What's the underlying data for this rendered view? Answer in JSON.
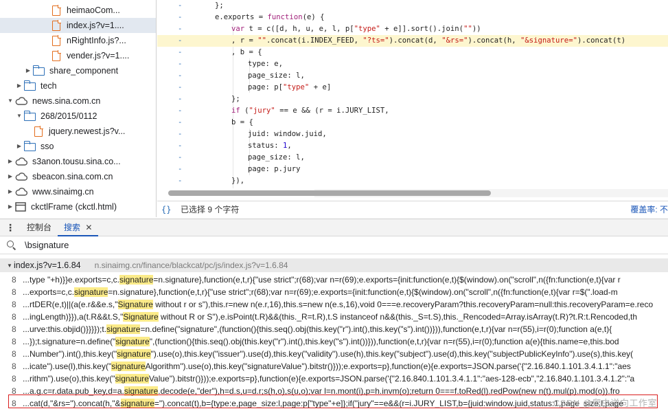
{
  "tree": {
    "items": [
      {
        "label": "heimaoCom...",
        "icon": "file-icon",
        "chevron": "",
        "depth": 5,
        "selected": false
      },
      {
        "label": "index.js?v=1....",
        "icon": "file-icon",
        "chevron": "",
        "depth": 5,
        "selected": true
      },
      {
        "label": "nRightInfo.js?...",
        "icon": "file-icon",
        "chevron": "",
        "depth": 5,
        "selected": false
      },
      {
        "label": "vender.js?v=1....",
        "icon": "file-icon",
        "chevron": "",
        "depth": 5,
        "selected": false
      },
      {
        "label": "share_component",
        "icon": "folder-icon",
        "chevron": "▶",
        "depth": 3,
        "selected": false
      },
      {
        "label": "tech",
        "icon": "folder-icon",
        "chevron": "▶",
        "depth": 2,
        "selected": false
      },
      {
        "label": "news.sina.com.cn",
        "icon": "cloud-icon",
        "chevron": "▼",
        "depth": 1,
        "selected": false
      },
      {
        "label": "268/2015/0112",
        "icon": "folder-icon",
        "chevron": "▼",
        "depth": 2,
        "selected": false
      },
      {
        "label": "jquery.newest.js?v...",
        "icon": "file-icon",
        "chevron": "",
        "depth": 3,
        "selected": false
      },
      {
        "label": "sso",
        "icon": "folder-icon",
        "chevron": "▶",
        "depth": 2,
        "selected": false
      },
      {
        "label": "s3anon.tousu.sina.co...",
        "icon": "cloud-icon",
        "chevron": "▶",
        "depth": 1,
        "selected": false
      },
      {
        "label": "sbeacon.sina.com.cn",
        "icon": "cloud-icon",
        "chevron": "▶",
        "depth": 1,
        "selected": false
      },
      {
        "label": "www.sinaimg.cn",
        "icon": "cloud-icon",
        "chevron": "▶",
        "depth": 1,
        "selected": false
      },
      {
        "label": "ckctlFrame (ckctl.html)",
        "icon": "frame-icon",
        "chevron": "▶",
        "depth": 1,
        "selected": false
      }
    ]
  },
  "code": {
    "lines": [
      {
        "text": "};",
        "indent": 1,
        "highlight": false
      },
      {
        "text": "e.exports = function(e) {",
        "indent": 1,
        "highlight": false
      },
      {
        "text": "var t = c([d, h, u, e, l, p[\"type\" + e]].sort().join(\"\"))",
        "indent": 2,
        "highlight": false
      },
      {
        "text": ", r = \"\".concat(i.INDEX_FEED, \"?ts=\").concat(d, \"&rs=\").concat(h, \"&signature=\").concat(t)",
        "indent": 2,
        "highlight": true
      },
      {
        "text": ", b = {",
        "indent": 2,
        "highlight": false
      },
      {
        "text": "type: e,",
        "indent": 3,
        "highlight": false
      },
      {
        "text": "page_size: l,",
        "indent": 3,
        "highlight": false
      },
      {
        "text": "page: p[\"type\" + e]",
        "indent": 3,
        "highlight": false
      },
      {
        "text": "};",
        "indent": 2,
        "highlight": false
      },
      {
        "text": "if (\"jury\" == e && (r = i.JURY_LIST,",
        "indent": 2,
        "highlight": false
      },
      {
        "text": "b = {",
        "indent": 2,
        "highlight": false
      },
      {
        "text": "juid: window.juid,",
        "indent": 3,
        "highlight": false
      },
      {
        "text": "status: 1,",
        "indent": 3,
        "highlight": false
      },
      {
        "text": "page_size: l,",
        "indent": 3,
        "highlight": false
      },
      {
        "text": "page: p.jury",
        "indent": 3,
        "highlight": false
      },
      {
        "text": "}),",
        "indent": 2,
        "highlight": false
      }
    ]
  },
  "status": {
    "brace_icon": "{}",
    "selection": "已选择 9 个字符",
    "coverage": "覆盖率: 不"
  },
  "drawer": {
    "menu_icon": "⋮",
    "tabs": [
      {
        "label": "控制台",
        "active": false,
        "closable": false
      },
      {
        "label": "搜索",
        "active": true,
        "closable": true
      }
    ],
    "close_glyph": "✕"
  },
  "search": {
    "query": "\\bsignature"
  },
  "results": {
    "file_name": "index.js?v=1.6.84",
    "file_path": "n.sinaimg.cn/finance/blackcat/pc/js/index.js?v=1.6.84",
    "rows": [
      {
        "line": "8",
        "text": "...type \"+h)}}e.exports=c,c.[[signature]]=n.signature},function(e,t,r){\"use strict\";r(68);var n=r(69);e.exports={init:function(e,t){$(window).on(\"scroll\",n({fn:function(e,t){var r"
      },
      {
        "line": "8",
        "text": "...exports=c,c.[[signature]]=n.signature},function(e,t,r){\"use strict\";r(68);var n=r(69);e.exports={init:function(e,t){$(window).on(\"scroll\",n({fn:function(e,t){var r=$(\".load-m"
      },
      {
        "line": "8",
        "text": "...rtDER(e,t)||(a(e.r&&e.s,\"[[Signature]] without r or s\"),this.r=new n(e.r,16),this.s=new n(e.s,16),void 0===e.recoveryParam?this.recoveryParam=null:this.recoveryParam=e.reco"
      },
      {
        "line": "8",
        "text": "...ingLength)}}),a(t.R&&t.S,\"[[Signature]] without R or S\"),e.isPoint(t.R)&&(this._R=t.R),t.S instanceof n&&(this._S=t.S),this._Rencoded=Array.isArray(t.R)?t.R:t.Rencoded,th"
      },
      {
        "line": "8",
        "text": "...urve:this.objid()}}}});t.[[signature]]=n.define(\"signature\",(function(){this.seq().obj(this.key(\"r\").int(),this.key(\"s\").int())})),function(e,t,r){var n=r(55),i=r(0);function a(e,t){"
      },
      {
        "line": "8",
        "text": "...});t.signature=n.define(\"[[signature]]\",(function(){this.seq().obj(this.key(\"r\").int(),this.key(\"s\").int())})),function(e,t,r){var n=r(55),i=r(0);function a(e){this.name=e,this.bod"
      },
      {
        "line": "8",
        "text": "...Number\").int(),this.key(\"[[signature]]\").use(o),this.key(\"issuer\").use(d),this.key(\"validity\").use(h),this.key(\"subject\").use(d),this.key(\"subjectPublicKeyInfo\").use(s),this.key("
      },
      {
        "line": "8",
        "text": "...icate\").use(l),this.key(\"[[signature]]Algorithm\").use(o),this.key(\"signatureValue\").bitstr()}));e.exports=p},function(e){e.exports=JSON.parse('{\"2.16.840.1.101.3.4.1.1\":\"aes"
      },
      {
        "line": "8",
        "text": "...rithm\").use(o),this.key(\"[[signature]]Value\").bitstr()}));e.exports=p},function(e){e.exports=JSON.parse('{\"2.16.840.1.101.3.4.1.1\":\"aes-128-ecb\",\"2.16.840.1.101.3.4.1.2\":\"a"
      },
      {
        "line": "8",
        "text": "...a.g.c=r.data.pub_key,d=a.[[signature]].decode(e,\"der\"),h=d.s,u=d.r;s(h,o),s(u,o);var l=n.mont(i),p=h.invm(o);return 0===f.toRed(l).redPow(new n(t).mul(p).mod(o)).fro"
      },
      {
        "line": "8",
        "text": "...cat(d,\"&rs=\").concat(h,\"&[[signature]]=\").concat(t),b={type:e,page_size:l,page:p[\"type\"+e]};if(\"jury\"==e&&(r=i.JURY_LIST,b={juid:window.juid,status:1,page_size:l,page"
      }
    ],
    "watermark": "CSDN @爬虫逆向工作室"
  },
  "colors": {
    "accent": "#1a56b8",
    "match_highlight": "#fbeb89",
    "line_highlight": "#fdf6cf",
    "outline": "#d91c1c"
  }
}
